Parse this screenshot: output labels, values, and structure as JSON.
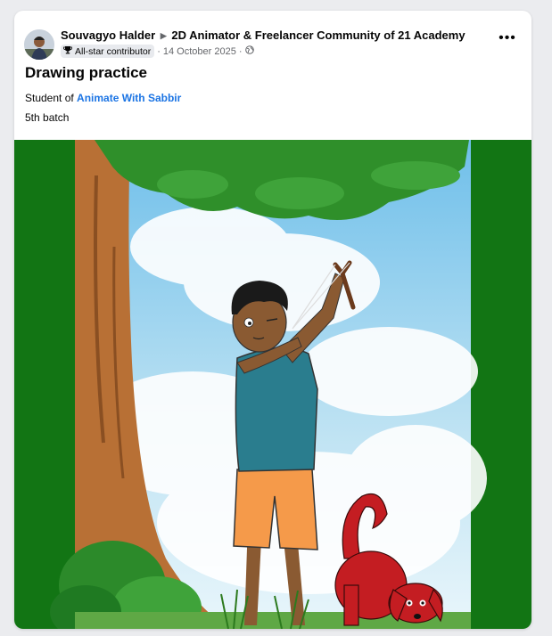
{
  "post": {
    "author": "Souvagyo Halder",
    "group": "2D Animator & Freelancer Community of 21 Academy",
    "badge": "All-star contributor",
    "date": "14 October 2025",
    "title": "Drawing practice",
    "line1_prefix": "Student of ",
    "line1_link": "Animate With Sabbir",
    "line2": "5th batch"
  },
  "icons": {
    "more": "more-options-icon",
    "trophy": "trophy-icon",
    "globe": "globe-icon",
    "separator": "triangle-right-icon"
  },
  "colors": {
    "link": "#1b74e4",
    "frame_green": "#127514",
    "sky": "#7cc6ec",
    "shirt": "#2a7d8e",
    "shorts": "#f59a4a",
    "dog": "#c41d22",
    "tree_trunk": "#b87035"
  }
}
